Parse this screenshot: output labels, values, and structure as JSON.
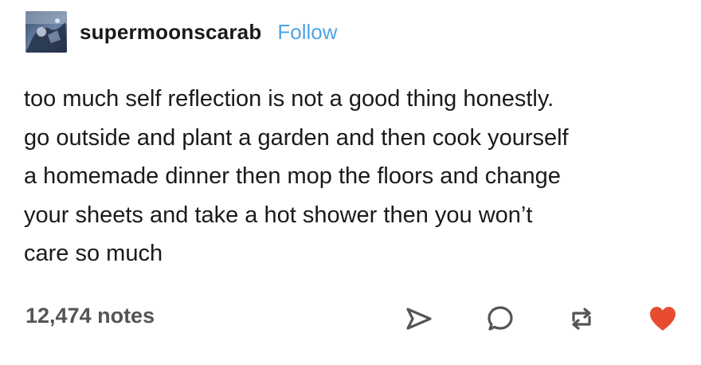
{
  "post": {
    "username": "supermoonscarab",
    "follow_label": "Follow",
    "body_lines": [
      "too much self reflection is not a good thing honestly.",
      "go outside and plant a garden and then cook yourself",
      "a homemade dinner then mop the floors and change",
      "your sheets and take a hot shower then you won’t",
      "care so much"
    ],
    "notes_count": "12,474 notes"
  },
  "icons": {
    "share": "share-arrow-icon",
    "reply": "reply-bubble-icon",
    "reblog": "reblog-icon",
    "like": "heart-icon"
  },
  "colors": {
    "follow_link": "#4ea4e5",
    "like_heart": "#e74c2e",
    "icon_stroke": "#555555",
    "text": "#1a1a1a"
  }
}
